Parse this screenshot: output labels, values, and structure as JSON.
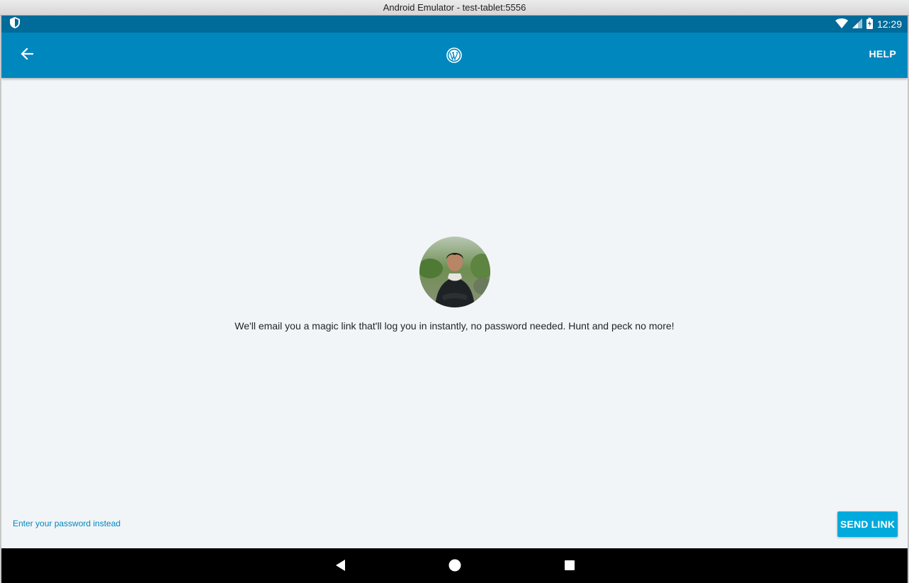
{
  "window": {
    "title": "Android Emulator - test-tablet:5556"
  },
  "status_bar": {
    "left_icon": "shield-icon",
    "icons": [
      "wifi-icon",
      "signal-icon",
      "battery-charging-icon"
    ],
    "time": "12:29"
  },
  "app_bar": {
    "back_icon": "arrow-left-icon",
    "logo_icon": "wordpress-logo-icon",
    "help_label": "HELP",
    "color": "#0087be"
  },
  "content": {
    "avatar": "user-avatar-photo",
    "message": "We'll email you a magic link that'll log you in instantly, no password needed. Hunt and peck no more!",
    "password_link_label": "Enter your password instead",
    "send_link_label": "SEND LINK",
    "accent_color": "#00aadc"
  },
  "nav_bar": {
    "buttons": [
      "back-triangle-icon",
      "home-circle-icon",
      "recents-square-icon"
    ]
  }
}
